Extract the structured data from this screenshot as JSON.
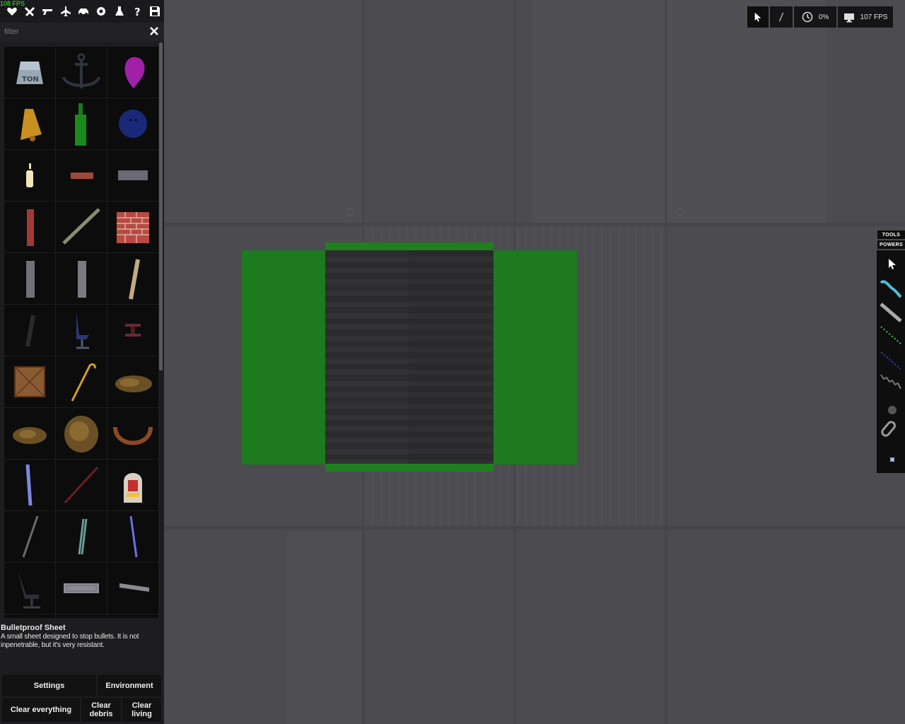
{
  "fps_corner": "108 FPS",
  "toolbar": {
    "icons": [
      "heart-icon",
      "crossed-tools-icon",
      "gun-icon",
      "plane-icon",
      "car-icon",
      "gear-icon",
      "flask-icon",
      "question-icon",
      "save-icon"
    ]
  },
  "filter": {
    "placeholder": "filter"
  },
  "catalog": {
    "items": [
      "1 ton weight",
      "anchor",
      "balloon",
      "bell",
      "bottle",
      "bowling ball",
      "candle",
      "brick",
      "stone brick",
      "brick pillar",
      "wooden rod",
      "brick wall",
      "stone pillar",
      "concrete pillar",
      "plank",
      "black rod",
      "office chair",
      "spring",
      "wooden crate",
      "cane",
      "dirt pile",
      "dirt pile small",
      "dirt mound",
      "horseshoe magnet",
      "glass tube",
      "red rod",
      "jukebox",
      "metal rod",
      "glass rods",
      "blue rod",
      "swivel chair",
      "metal plate",
      "bullet sheet"
    ]
  },
  "description": {
    "title": "Bulletproof Sheet",
    "text": "A small sheet designed to stop bullets. It is not inpenetrable, but it's very resistant."
  },
  "buttons": {
    "settings": "Settings",
    "environment": "Environment",
    "clear_everything": "Clear everything",
    "clear_debris": "Clear debris",
    "clear_living": "Clear living"
  },
  "hud": {
    "time_scale": "0%",
    "fps": "107 FPS"
  },
  "tool_tabs": {
    "tools": "TOOLS",
    "powers": "POWERS"
  },
  "colors": {
    "green": "#1e7a1e",
    "panel": "#1d1d1f",
    "viewport": "#4b4b50"
  }
}
